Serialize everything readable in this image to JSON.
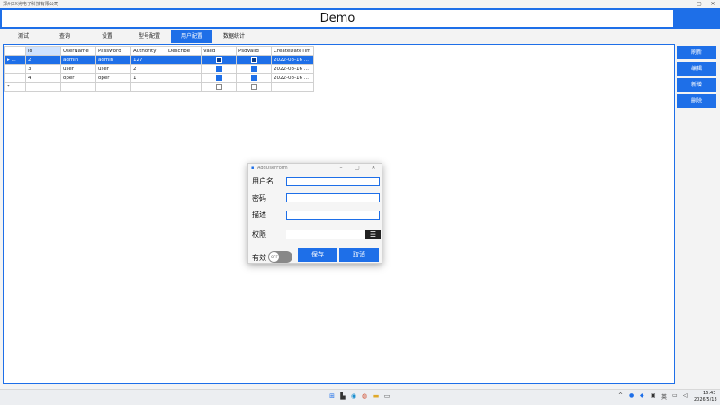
{
  "window": {
    "title": "郑州XX光电子科技有限公司",
    "controls": [
      "–",
      "▢",
      "✕"
    ]
  },
  "header": {
    "title": "Demo"
  },
  "tabs": [
    {
      "label": "测试",
      "active": false
    },
    {
      "label": "查询",
      "active": false
    },
    {
      "label": "设置",
      "active": false
    },
    {
      "label": "型号配置",
      "active": false
    },
    {
      "label": "用户配置",
      "active": true
    },
    {
      "label": "数据统计",
      "active": false
    }
  ],
  "grid": {
    "columns": [
      "id",
      "UserName",
      "Password",
      "Authority",
      "Describe",
      "Valid",
      "PsdValid",
      "CreateDateTim"
    ],
    "rows": [
      {
        "marker": "▸ ...",
        "id": "2",
        "username": "admin",
        "password": "admin",
        "authority": "127",
        "describe": "",
        "valid": true,
        "psdvalid": true,
        "created": "2022-08-16 ...",
        "selected": true
      },
      {
        "marker": "",
        "id": "3",
        "username": "user",
        "password": "user",
        "authority": "2",
        "describe": "",
        "valid": true,
        "psdvalid": true,
        "created": "2022-08-16 ...",
        "selected": false
      },
      {
        "marker": "",
        "id": "4",
        "username": "oper",
        "password": "oper",
        "authority": "1",
        "describe": "",
        "valid": true,
        "psdvalid": true,
        "created": "2022-08-16 ...",
        "selected": false
      }
    ],
    "new_row_marker": "*"
  },
  "actions": {
    "refresh": "刷新",
    "edit": "编辑",
    "add": "新增",
    "delete": "删除"
  },
  "dialog": {
    "title": "AddUserForm",
    "controls": [
      "–",
      "▢",
      "✕"
    ],
    "username_label": "用户名",
    "password_label": "密码",
    "describe_label": "描述",
    "authority_label": "权限",
    "valid_label": "有效",
    "toggle_text": "OFF",
    "toggle_on": false,
    "save_label": "保存",
    "cancel_label": "取消"
  },
  "taskbar": {
    "icons": [
      "windows-icon",
      "file-explorer-icon",
      "edge-icon",
      "chrome-icon",
      "folder-icon",
      "app-icon"
    ],
    "tray": [
      "^",
      "英"
    ],
    "time": "16:43",
    "date": "2026/5/13"
  },
  "colors": {
    "accent": "#1e6fe8"
  }
}
